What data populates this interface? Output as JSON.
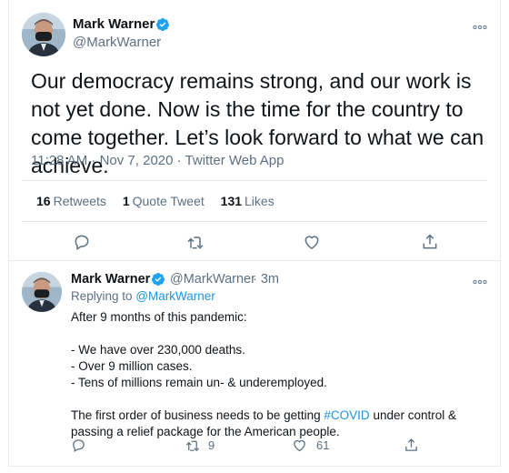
{
  "main_tweet": {
    "author_name": "Mark Warner",
    "author_handle": "@MarkWarner",
    "more_icon": "more-horizontal-icon",
    "text": "Our democracy remains strong, and our work is not yet done. Now is the time for the country to come together. Let’s look forward to what we can achieve.",
    "timestamp": "11:28 AM · Nov 7, 2020 · Twitter Web App",
    "stats": {
      "retweets_count": "16",
      "retweets_label": "Retweets",
      "quote_count": "1",
      "quote_label": "Quote Tweet",
      "likes_count": "131",
      "likes_label": "Likes"
    },
    "actions": [
      "reply-icon",
      "retweet-icon",
      "like-icon",
      "share-icon"
    ]
  },
  "reply_tweet": {
    "author_name": "Mark Warner",
    "author_handle": "@MarkWarner",
    "age": "· 3m",
    "replying_prefix": "Replying to",
    "replying_handle": "@MarkWarner",
    "lines": {
      "l1": "After 9 months of this pandemic:",
      "l2": "- We have over 230,000 deaths.",
      "l3": "- Over 9 million cases.",
      "l4": "- Tens of millions remain un- & underemployed.",
      "l5_pre": "The first order of business needs to be getting ",
      "l5_hashtag": "#COVID",
      "l5_post": " under control &",
      "l6": "passing a relief package for the American people."
    },
    "retweet_count": "9",
    "like_count": "61"
  },
  "colors": {
    "text": "#0f1419",
    "secondary": "#5b7083",
    "link": "#1b95e0",
    "verified": "#1da1f2",
    "border": "#e6ecf0"
  }
}
